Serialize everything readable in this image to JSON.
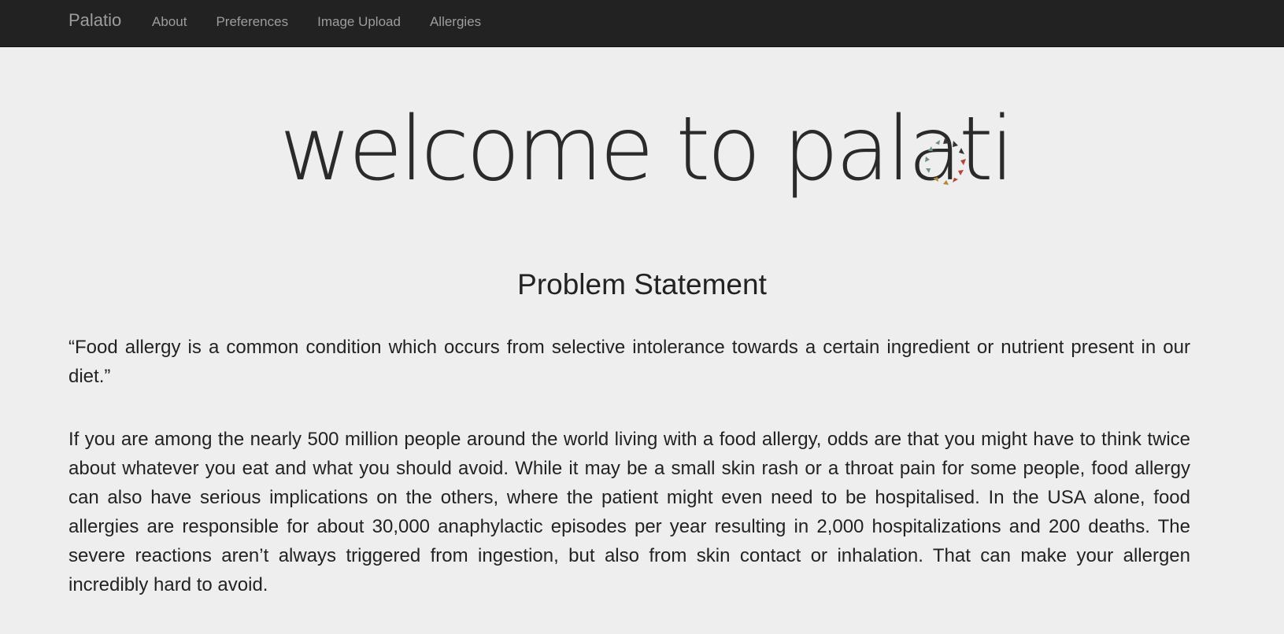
{
  "navbar": {
    "brand": "Palatio",
    "links": [
      "About",
      "Preferences",
      "Image Upload",
      "Allergies"
    ]
  },
  "hero": {
    "title": "welcome to palati",
    "logo_icon": "palatio-o-logo-icon",
    "logo_colors": [
      "#333333",
      "#6e8f86",
      "#b5443e",
      "#b38a2f"
    ]
  },
  "section": {
    "heading": "Problem Statement",
    "quote": "“Food allergy is a common condition which occurs from selective intolerance towards a certain ingredient or nutrient present in our diet.”",
    "body": "If you are among the nearly 500 million people around the world living with a food allergy, odds are that you might have to think twice about whatever you eat and what you should avoid. While it may be a small skin rash or a throat pain for some people, food allergy can also have serious implications on the others, where the patient might even need to be hospitalised. In the USA alone, food allergies are responsible for about 30,000 anaphylactic episodes per year resulting in 2,000 hospitalizations and 200 deaths. The severe reactions aren’t always triggered from ingestion, but also from skin contact or inhalation. That can make your allergen incredibly hard to avoid."
  }
}
